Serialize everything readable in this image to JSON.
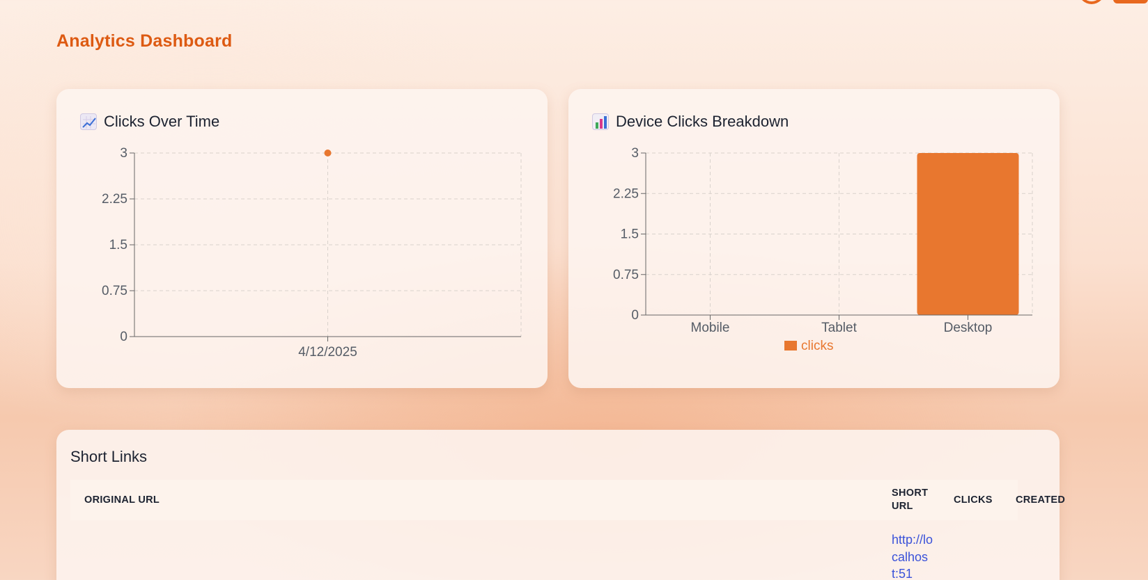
{
  "page": {
    "title": "Analytics Dashboard"
  },
  "clicks_card": {
    "title": "Clicks Over Time",
    "icon": "chart-increasing-icon"
  },
  "device_card": {
    "title": "Device Clicks Breakdown",
    "icon": "bar-chart-icon"
  },
  "colors": {
    "accent": "#e8772f",
    "title": "#dd5a12",
    "link": "#3a52d9"
  },
  "chart_data": [
    {
      "type": "line",
      "title": "Clicks Over Time",
      "x": [
        "4/12/2025"
      ],
      "series": [
        {
          "values": [
            3
          ]
        }
      ],
      "ylim": [
        0,
        3
      ],
      "yticks": [
        "0",
        "0.75",
        "1.5",
        "2.25",
        "3"
      ],
      "grid": true,
      "color": "#e8772f"
    },
    {
      "type": "bar",
      "title": "Device Clicks Breakdown",
      "categories": [
        "Mobile",
        "Tablet",
        "Desktop"
      ],
      "series": [
        {
          "name": "clicks",
          "values": [
            0,
            0,
            3
          ]
        }
      ],
      "ylim": [
        0,
        3
      ],
      "yticks": [
        "0",
        "0.75",
        "1.5",
        "2.25",
        "3"
      ],
      "grid": true,
      "legend": "bottom",
      "color": "#e8772f"
    }
  ],
  "links_table": {
    "title": "Short Links",
    "columns": [
      "ORIGINAL URL",
      "SHORT URL",
      "CLICKS",
      "CREATED"
    ],
    "rows": [
      {
        "original_url": "",
        "short_url": "http://localhost:51",
        "clicks": "",
        "created": ""
      }
    ]
  }
}
